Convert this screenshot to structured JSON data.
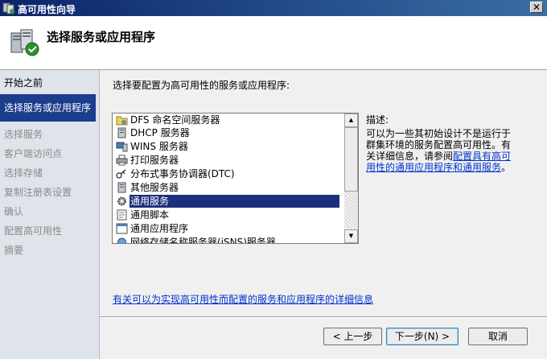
{
  "window": {
    "title": "高可用性向导",
    "close_symbol": "✕"
  },
  "header": {
    "heading": "选择服务或应用程序"
  },
  "sidebar": {
    "steps": [
      {
        "label": "开始之前",
        "state": "normal"
      },
      {
        "label": "选择服务或应用程序",
        "state": "active"
      },
      {
        "label": "选择服务",
        "state": "disabled"
      },
      {
        "label": "客户端访问点",
        "state": "disabled"
      },
      {
        "label": "选择存储",
        "state": "disabled"
      },
      {
        "label": "复制注册表设置",
        "state": "disabled"
      },
      {
        "label": "确认",
        "state": "disabled"
      },
      {
        "label": "配置高可用性",
        "state": "disabled"
      },
      {
        "label": "摘要",
        "state": "disabled"
      }
    ]
  },
  "main": {
    "instruction": "选择要配置为高可用性的服务或应用程序:",
    "list": {
      "items": [
        {
          "label": "DFS 命名空间服务器",
          "icon": "folder-share-icon"
        },
        {
          "label": "DHCP 服务器",
          "icon": "server-icon"
        },
        {
          "label": "WINS 服务器",
          "icon": "server-monitor-icon"
        },
        {
          "label": "打印服务器",
          "icon": "printer-icon"
        },
        {
          "label": "分布式事务协调器(DTC)",
          "icon": "coordinator-icon"
        },
        {
          "label": "其他服务器",
          "icon": "server-icon"
        },
        {
          "label": "通用服务",
          "icon": "gear-icon",
          "selected": true
        },
        {
          "label": "通用脚本",
          "icon": "script-icon"
        },
        {
          "label": "通用应用程序",
          "icon": "application-icon"
        },
        {
          "label": "网络存储名称服务器(iSNS)服务器",
          "icon": "network-icon"
        }
      ]
    },
    "description": {
      "label": "描述:",
      "text": "可以为一些其初始设计不是运行于群集环境的服务配置高可用性。有关详细信息，请参阅",
      "link": "配置具有高可用性的通用应用程序和通用服务",
      "suffix": "。"
    },
    "more_link": "有关可以为实现高可用性而配置的服务和应用程序的详细信息"
  },
  "buttons": {
    "back": "< 上一步",
    "next": "下一步(N) >",
    "cancel": "取消"
  }
}
